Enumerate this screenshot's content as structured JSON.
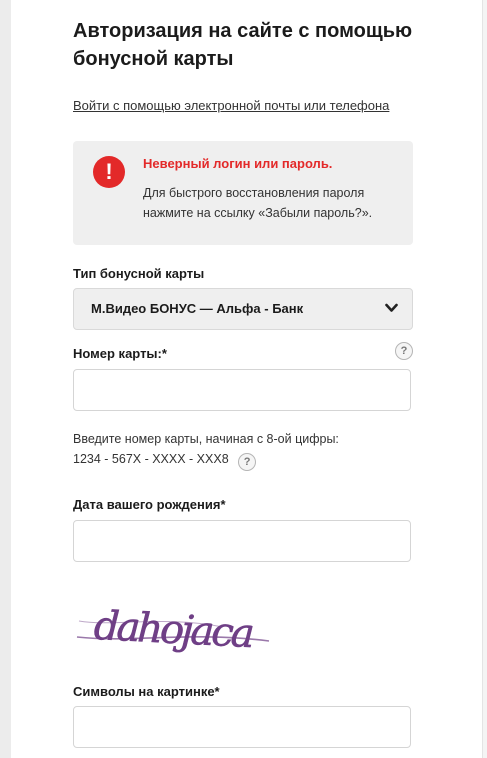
{
  "page": {
    "title": "Авторизация на сайте с помощью бонусной карты",
    "alt_login_link": "Войти с помощью электронной почты или телефона"
  },
  "alert": {
    "icon": "exclamation-icon",
    "title": "Неверный логин или пароль.",
    "text": "Для быстрого восстановления пароля нажмите на ссылку «Забыли пароль?».",
    "color": "#e32929"
  },
  "card_type": {
    "label": "Тип бонусной карты",
    "selected": "М.Видео БОНУС — Альфа - Банк"
  },
  "card_number": {
    "label": "Номер карты:*",
    "value": "",
    "hint_line1": "Введите номер карты, начиная с 8-ой цифры:",
    "hint_line2": "1234 - 567X - XXXX - XXX8",
    "help_glyph": "?"
  },
  "birth_date": {
    "label": "Дата вашего рождения*",
    "value": ""
  },
  "captcha": {
    "text": "dahojaca",
    "label": "Символы на картинке*",
    "value": "",
    "color": "#6f3f86"
  }
}
